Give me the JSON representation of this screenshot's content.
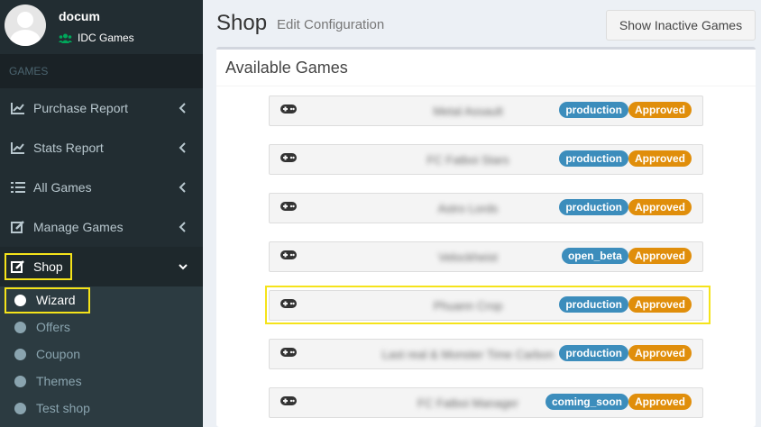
{
  "user": {
    "name": "docum",
    "team": "IDC Games"
  },
  "sidebar": {
    "section_header": "GAMES",
    "items": [
      {
        "label": "Purchase Report"
      },
      {
        "label": "Stats Report"
      },
      {
        "label": "All Games"
      },
      {
        "label": "Manage Games"
      },
      {
        "label": "Shop"
      }
    ],
    "submenu": [
      {
        "label": "Wizard"
      },
      {
        "label": "Offers"
      },
      {
        "label": "Coupon"
      },
      {
        "label": "Themes"
      },
      {
        "label": "Test shop"
      }
    ]
  },
  "header": {
    "title": "Shop",
    "subtitle": "Edit Configuration",
    "inactive_button": "Show Inactive Games"
  },
  "box": {
    "title": "Available Games"
  },
  "games": [
    {
      "name": "Metal Assault",
      "env": "production",
      "status": "Approved"
    },
    {
      "name": "FC Fatboi Stars",
      "env": "production",
      "status": "Approved"
    },
    {
      "name": "Astro Lords",
      "env": "production",
      "status": "Approved"
    },
    {
      "name": "Velockheist",
      "env": "open_beta",
      "status": "Approved"
    },
    {
      "name": "Phuann Crop",
      "env": "production",
      "status": "Approved"
    },
    {
      "name": "Last real & Monster Time Carbon",
      "env": "production",
      "status": "Approved"
    },
    {
      "name": "FC Fatboi Manager",
      "env": "coming_soon",
      "status": "Approved"
    }
  ],
  "colors": {
    "sidebar_bg": "#222d32",
    "env_badge": "#3c8dbc",
    "status_badge": "#e08e0b",
    "highlight": "#f5e31a"
  }
}
